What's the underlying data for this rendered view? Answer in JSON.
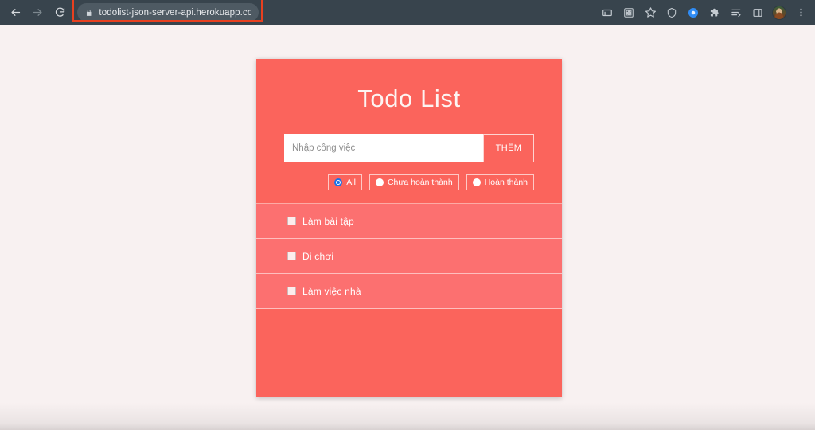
{
  "browser": {
    "back_icon": "arrow-left-icon",
    "forward_icon": "arrow-right-icon",
    "reload_icon": "reload-icon",
    "lock_icon": "lock-icon",
    "url": "todolist-json-server-api.herokuapp.com",
    "toolbar_icons": [
      {
        "name": "cast-icon",
        "glyph": "▭"
      },
      {
        "name": "qr-code-icon",
        "glyph": "⌘"
      },
      {
        "name": "bookmark-star-icon",
        "glyph": "☆"
      },
      {
        "name": "shield-icon",
        "glyph": "⛨"
      },
      {
        "name": "extension-dot-icon",
        "glyph": "●"
      },
      {
        "name": "puzzle-extensions-icon",
        "glyph": "❖"
      },
      {
        "name": "reading-list-icon",
        "glyph": "≣"
      },
      {
        "name": "side-panel-icon",
        "glyph": "▣"
      }
    ],
    "avatar_name": "profile-avatar",
    "menu_icon": "three-dot-menu-icon",
    "highlight_color": "#e8401f"
  },
  "app": {
    "title": "Todo List",
    "input_placeholder": "Nhập công việc",
    "input_value": "",
    "add_button": "THÊM",
    "filters": [
      {
        "label": "All",
        "selected": true
      },
      {
        "label": "Chưa hoàn thành",
        "selected": false
      },
      {
        "label": "Hoàn thành",
        "selected": false
      }
    ],
    "todos": [
      {
        "label": "Làm bài tập",
        "done": false
      },
      {
        "label": "Đi chơi",
        "done": false
      },
      {
        "label": "Làm việc nhà",
        "done": false
      }
    ],
    "colors": {
      "card_background": "#fb645c",
      "row_background": "#fc7070",
      "page_background": "#f8f1f1",
      "radio_selected": "#1a73e8"
    }
  }
}
